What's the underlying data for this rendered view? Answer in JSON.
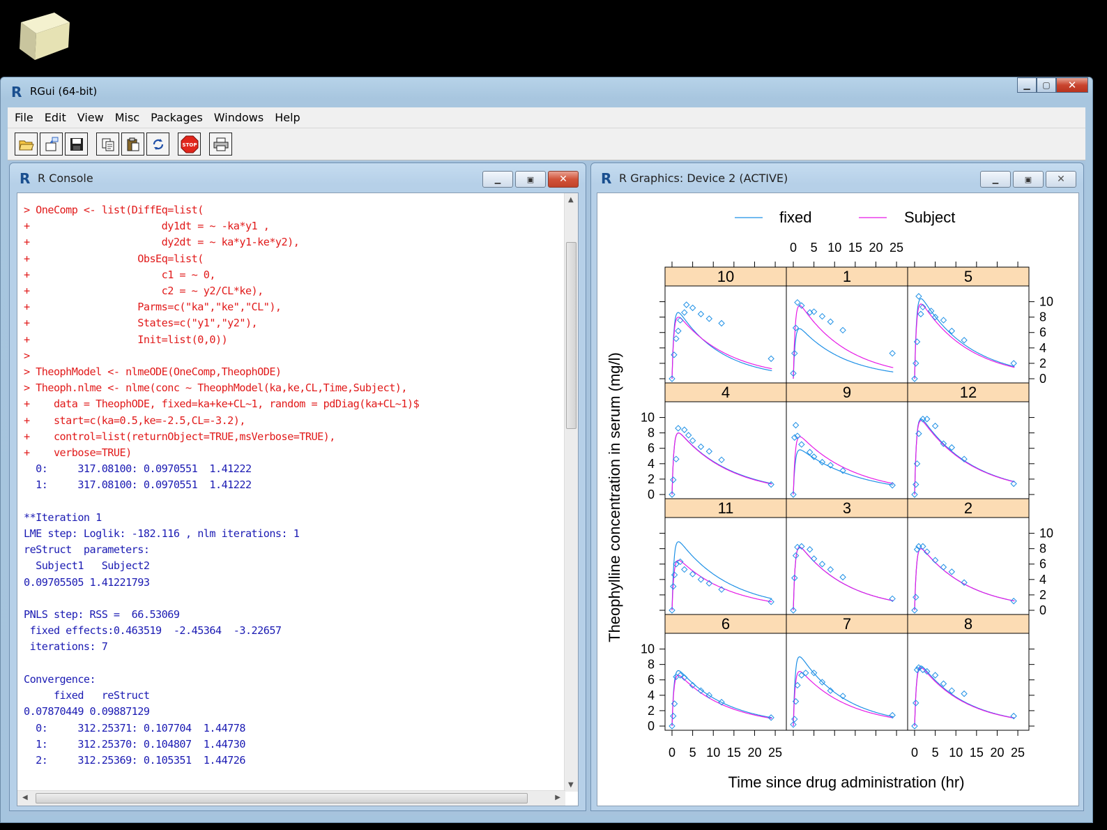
{
  "app": {
    "title": "RGui (64-bit)"
  },
  "menubar": {
    "items": [
      "File",
      "Edit",
      "View",
      "Misc",
      "Packages",
      "Windows",
      "Help"
    ]
  },
  "toolbar": {
    "buttons": [
      "open-script",
      "load-workspace",
      "save-workspace",
      "copy",
      "paste",
      "copy-paste",
      "stop",
      "print"
    ]
  },
  "console": {
    "title": "R Console",
    "lines": [
      {
        "t": "in",
        "s": "> OneComp <- list(DiffEq=list("
      },
      {
        "t": "in",
        "s": "+                      dy1dt = ~ -ka*y1 ,"
      },
      {
        "t": "in",
        "s": "+                      dy2dt = ~ ka*y1-ke*y2),"
      },
      {
        "t": "in",
        "s": "+                  ObsEq=list("
      },
      {
        "t": "in",
        "s": "+                      c1 = ~ 0,"
      },
      {
        "t": "in",
        "s": "+                      c2 = ~ y2/CL*ke),"
      },
      {
        "t": "in",
        "s": "+                  Parms=c(\"ka\",\"ke\",\"CL\"),"
      },
      {
        "t": "in",
        "s": "+                  States=c(\"y1\",\"y2\"),"
      },
      {
        "t": "in",
        "s": "+                  Init=list(0,0))"
      },
      {
        "t": "in",
        "s": ">"
      },
      {
        "t": "in",
        "s": "> TheophModel <- nlmeODE(OneComp,TheophODE)"
      },
      {
        "t": "in",
        "s": "> Theoph.nlme <- nlme(conc ~ TheophModel(ka,ke,CL,Time,Subject),"
      },
      {
        "t": "in",
        "s": "+    data = TheophODE, fixed=ka+ke+CL~1, random = pdDiag(ka+CL~1)$"
      },
      {
        "t": "in",
        "s": "+    start=c(ka=0.5,ke=-2.5,CL=-3.2),"
      },
      {
        "t": "in",
        "s": "+    control=list(returnObject=TRUE,msVerbose=TRUE),"
      },
      {
        "t": "in",
        "s": "+    verbose=TRUE)"
      },
      {
        "t": "out",
        "s": "  0:     317.08100: 0.0970551  1.41222"
      },
      {
        "t": "out",
        "s": "  1:     317.08100: 0.0970551  1.41222"
      },
      {
        "t": "out",
        "s": ""
      },
      {
        "t": "out",
        "s": "**Iteration 1"
      },
      {
        "t": "out",
        "s": "LME step: Loglik: -182.116 , nlm iterations: 1"
      },
      {
        "t": "out",
        "s": "reStruct  parameters:"
      },
      {
        "t": "out",
        "s": "  Subject1   Subject2"
      },
      {
        "t": "out",
        "s": "0.09705505 1.41221793"
      },
      {
        "t": "out",
        "s": ""
      },
      {
        "t": "out",
        "s": "PNLS step: RSS =  66.53069"
      },
      {
        "t": "out",
        "s": " fixed effects:0.463519  -2.45364  -3.22657"
      },
      {
        "t": "out",
        "s": " iterations: 7"
      },
      {
        "t": "out",
        "s": ""
      },
      {
        "t": "out",
        "s": "Convergence:"
      },
      {
        "t": "out",
        "s": "     fixed   reStruct"
      },
      {
        "t": "out",
        "s": "0.07870449 0.09887129"
      },
      {
        "t": "out",
        "s": "  0:     312.25371: 0.107704  1.44778"
      },
      {
        "t": "out",
        "s": "  1:     312.25370: 0.104807  1.44730"
      },
      {
        "t": "out",
        "s": "  2:     312.25369: 0.105351  1.44726"
      }
    ]
  },
  "graphics": {
    "title": "R Graphics: Device 2 (ACTIVE)",
    "chart_data": {
      "type": "line",
      "xlabel": "Time since drug administration (hr)",
      "ylabel": "Theophylline concentration in serum (mg/l)",
      "legend": [
        {
          "name": "fixed",
          "color": "#1e90e6"
        },
        {
          "name": "Subject",
          "color": "#e619e6"
        }
      ],
      "legend_placement": "top",
      "xlim": [
        0,
        25
      ],
      "ylim": [
        0,
        11.5
      ],
      "x_ticks": [
        0,
        5,
        10,
        15,
        20,
        25
      ],
      "y_ticks": [
        0,
        2,
        4,
        6,
        8,
        10
      ],
      "panels": [
        {
          "label": "10",
          "fixed": [
            8.6,
            0.095
          ],
          "subject": [
            8.0,
            0.082
          ],
          "points": [
            [
              0,
              0
            ],
            [
              0.5,
              3.1
            ],
            [
              1,
              5.2
            ],
            [
              1.5,
              6.2
            ],
            [
              2,
              7.6
            ],
            [
              3,
              8.6
            ],
            [
              3.5,
              9.6
            ],
            [
              5,
              9.2
            ],
            [
              7,
              8.4
            ],
            [
              9,
              7.8
            ],
            [
              12,
              7.2
            ],
            [
              24,
              2.6
            ]
          ]
        },
        {
          "label": "1",
          "fixed": [
            6.5,
            0.09
          ],
          "subject": [
            9.5,
            0.085
          ],
          "points": [
            [
              0,
              0.7
            ],
            [
              0.3,
              3.3
            ],
            [
              0.6,
              6.6
            ],
            [
              1,
              9.9
            ],
            [
              2,
              9.5
            ],
            [
              4,
              8.6
            ],
            [
              5,
              8.7
            ],
            [
              7,
              8.1
            ],
            [
              9,
              7.4
            ],
            [
              12,
              6.3
            ],
            [
              24,
              3.3
            ]
          ]
        },
        {
          "label": "5",
          "fixed": [
            10.4,
            0.085
          ],
          "subject": [
            9.7,
            0.085
          ],
          "points": [
            [
              0,
              0
            ],
            [
              0.3,
              2.0
            ],
            [
              0.6,
              4.8
            ],
            [
              1,
              10.7
            ],
            [
              1.5,
              8.4
            ],
            [
              2,
              9.3
            ],
            [
              4,
              8.8
            ],
            [
              5,
              8.0
            ],
            [
              7,
              7.6
            ],
            [
              9,
              6.2
            ],
            [
              12,
              5.0
            ],
            [
              24,
              2.0
            ]
          ]
        },
        {
          "label": "4",
          "fixed": [
            8.0,
            0.078
          ],
          "subject": [
            8.0,
            0.08
          ],
          "points": [
            [
              0,
              0
            ],
            [
              0.3,
              1.9
            ],
            [
              1,
              4.6
            ],
            [
              1.5,
              8.6
            ],
            [
              3,
              8.4
            ],
            [
              4,
              7.7
            ],
            [
              5,
              7.0
            ],
            [
              7,
              6.2
            ],
            [
              9,
              5.6
            ],
            [
              12,
              4.5
            ],
            [
              24,
              1.3
            ]
          ]
        },
        {
          "label": "9",
          "fixed": [
            5.8,
            0.07
          ],
          "subject": [
            7.5,
            0.075
          ],
          "points": [
            [
              0,
              0
            ],
            [
              0.3,
              7.4
            ],
            [
              0.6,
              9.0
            ],
            [
              1,
              7.6
            ],
            [
              2,
              6.5
            ],
            [
              4,
              5.5
            ],
            [
              5,
              4.9
            ],
            [
              7,
              4.2
            ],
            [
              9,
              3.8
            ],
            [
              12,
              3.1
            ],
            [
              24,
              1.2
            ]
          ]
        },
        {
          "label": "12",
          "fixed": [
            9.8,
            0.08
          ],
          "subject": [
            9.6,
            0.08
          ],
          "points": [
            [
              0,
              0
            ],
            [
              0.3,
              1.3
            ],
            [
              0.6,
              4.0
            ],
            [
              1,
              7.9
            ],
            [
              2,
              9.8
            ],
            [
              3,
              9.8
            ],
            [
              5,
              8.9
            ],
            [
              7,
              6.6
            ],
            [
              9,
              6.1
            ],
            [
              12,
              4.6
            ],
            [
              24,
              1.4
            ]
          ]
        },
        {
          "label": "11",
          "fixed": [
            8.9,
            0.08
          ],
          "subject": [
            6.5,
            0.08
          ],
          "points": [
            [
              0,
              0
            ],
            [
              0.3,
              3.1
            ],
            [
              0.6,
              4.6
            ],
            [
              1,
              6.0
            ],
            [
              2,
              6.3
            ],
            [
              3,
              5.3
            ],
            [
              5,
              4.7
            ],
            [
              7,
              4.0
            ],
            [
              9,
              3.5
            ],
            [
              12,
              2.7
            ],
            [
              24,
              1.1
            ]
          ]
        },
        {
          "label": "3",
          "fixed": [
            8.2,
            0.085
          ],
          "subject": [
            8.2,
            0.085
          ],
          "points": [
            [
              0,
              0
            ],
            [
              0.3,
              4.2
            ],
            [
              0.6,
              7.1
            ],
            [
              1,
              8.2
            ],
            [
              2,
              8.3
            ],
            [
              4,
              7.9
            ],
            [
              5,
              6.7
            ],
            [
              7,
              6.0
            ],
            [
              9,
              5.3
            ],
            [
              12,
              4.3
            ],
            [
              24,
              1.5
            ]
          ]
        },
        {
          "label": "2",
          "fixed": [
            8.0,
            0.085
          ],
          "subject": [
            8.0,
            0.085
          ],
          "points": [
            [
              0,
              0
            ],
            [
              0.3,
              1.7
            ],
            [
              0.6,
              7.9
            ],
            [
              1,
              8.3
            ],
            [
              2,
              8.3
            ],
            [
              3,
              7.6
            ],
            [
              5,
              6.5
            ],
            [
              7,
              5.6
            ],
            [
              9,
              5.0
            ],
            [
              12,
              3.6
            ],
            [
              24,
              1.2
            ]
          ]
        },
        {
          "label": "6",
          "fixed": [
            7.2,
            0.085
          ],
          "subject": [
            6.6,
            0.085
          ],
          "points": [
            [
              0,
              0
            ],
            [
              0.3,
              1.3
            ],
            [
              0.6,
              2.9
            ],
            [
              1,
              6.4
            ],
            [
              2,
              6.6
            ],
            [
              3,
              6.3
            ],
            [
              5,
              5.3
            ],
            [
              7,
              4.6
            ],
            [
              9,
              4.0
            ],
            [
              12,
              3.1
            ],
            [
              24,
              1.1
            ]
          ]
        },
        {
          "label": "7",
          "fixed": [
            9.0,
            0.09
          ],
          "subject": [
            7.1,
            0.085
          ],
          "points": [
            [
              0,
              0.2
            ],
            [
              0.3,
              0.9
            ],
            [
              0.6,
              3.2
            ],
            [
              1,
              5.3
            ],
            [
              2,
              6.6
            ],
            [
              3,
              6.9
            ],
            [
              5,
              6.9
            ],
            [
              7,
              5.7
            ],
            [
              9,
              4.6
            ],
            [
              12,
              3.9
            ],
            [
              24,
              1.4
            ]
          ]
        },
        {
          "label": "8",
          "fixed": [
            7.8,
            0.09
          ],
          "subject": [
            7.6,
            0.09
          ],
          "points": [
            [
              0,
              0
            ],
            [
              0.3,
              3.0
            ],
            [
              0.6,
              7.3
            ],
            [
              1,
              7.6
            ],
            [
              2,
              7.3
            ],
            [
              3,
              7.1
            ],
            [
              5,
              6.6
            ],
            [
              7,
              5.5
            ],
            [
              9,
              4.6
            ],
            [
              12,
              4.2
            ],
            [
              24,
              1.3
            ]
          ]
        }
      ]
    }
  }
}
